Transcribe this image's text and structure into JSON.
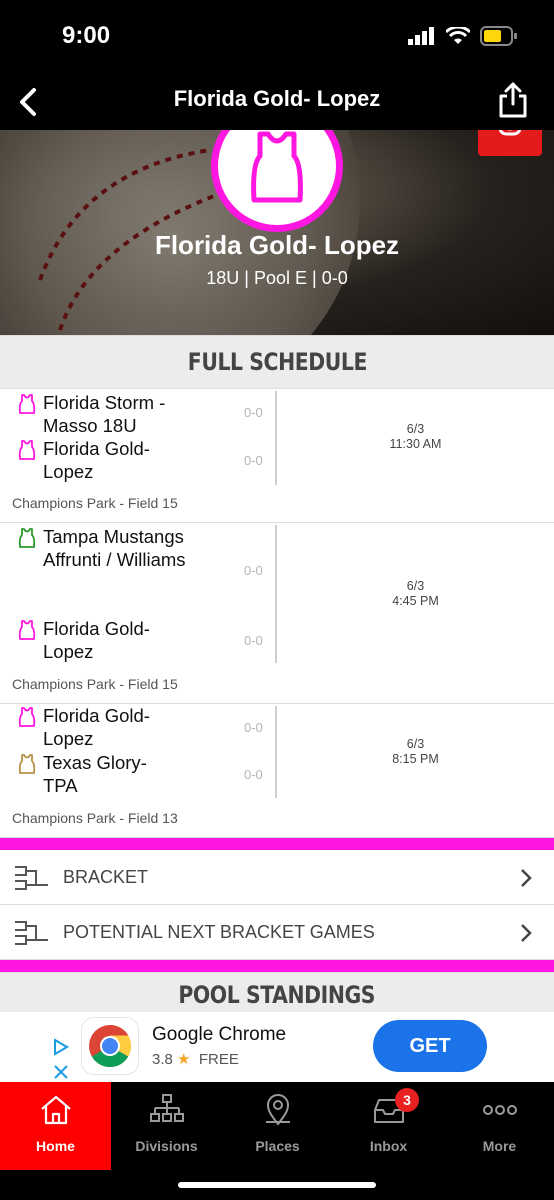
{
  "status_bar": {
    "time": "9:00"
  },
  "nav": {
    "title": "Florida Gold- Lopez"
  },
  "hero": {
    "team_name": "Florida Gold- Lopez",
    "subtitle": "18U | Pool E | 0-0",
    "logo_color": "#ff16e0"
  },
  "schedule": {
    "header": "FULL SCHEDULE",
    "games": [
      {
        "home": {
          "name": "Florida Storm - Masso 18U",
          "score": "0-0",
          "icon_color": "#ff16e0"
        },
        "away": {
          "name": "Florida Gold- Lopez",
          "score": "0-0",
          "icon_color": "#ff16e0"
        },
        "date": "6/3",
        "time": "11:30 AM",
        "venue": "Champions Park - Field 15"
      },
      {
        "home": {
          "name": "Tampa Mustangs Affrunti / Williams",
          "score": "0-0",
          "icon_color": "#2a9a2a"
        },
        "away": {
          "name": "Florida Gold- Lopez",
          "score": "0-0",
          "icon_color": "#ff16e0"
        },
        "date": "6/3",
        "time": "4:45 PM",
        "venue": "Champions Park - Field 15"
      },
      {
        "home": {
          "name": "Florida Gold- Lopez",
          "score": "0-0",
          "icon_color": "#ff16e0"
        },
        "away": {
          "name": "Texas Glory-TPA",
          "score": "0-0",
          "icon_color": "#b89048"
        },
        "date": "6/3",
        "time": "8:15 PM",
        "venue": "Champions Park - Field 13"
      }
    ]
  },
  "links": [
    {
      "label": "BRACKET"
    },
    {
      "label": "POTENTIAL NEXT BRACKET GAMES"
    }
  ],
  "standings": {
    "header": "POOL STANDINGS"
  },
  "ad": {
    "title": "Google Chrome",
    "rating": "3.8",
    "star": "★",
    "price": "FREE",
    "cta": "GET"
  },
  "tabs": [
    {
      "label": "Home",
      "icon": "home-icon",
      "active": true
    },
    {
      "label": "Divisions",
      "icon": "divisions-icon"
    },
    {
      "label": "Places",
      "icon": "location-pin-icon"
    },
    {
      "label": "Inbox",
      "icon": "inbox-icon",
      "badge": "3"
    },
    {
      "label": "More",
      "icon": "more-dots-icon"
    }
  ],
  "colors": {
    "accent": "#ff16e0",
    "active_tab": "#ff0000",
    "cta": "#1a73e8"
  }
}
